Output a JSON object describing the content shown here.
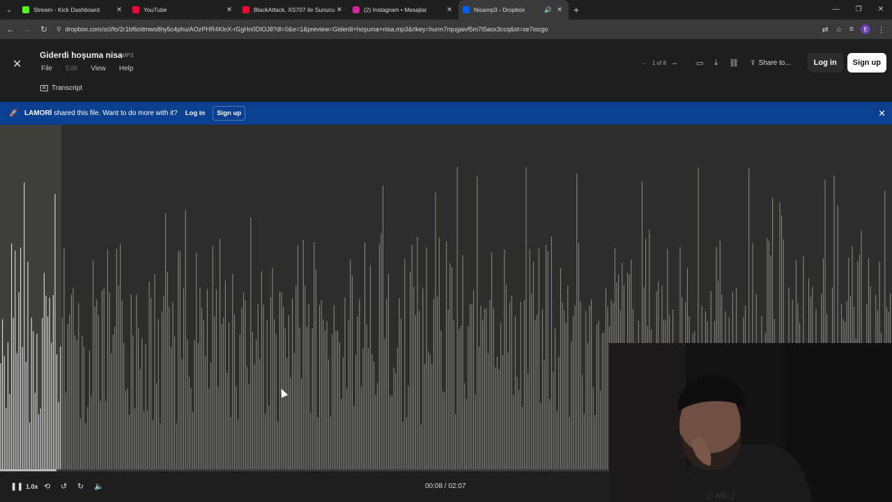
{
  "browser": {
    "tabs": [
      {
        "title": "Stream - Kick Dashboard",
        "favicon": "kick-icon",
        "color": "#53fc18",
        "active": false
      },
      {
        "title": "YouTube",
        "favicon": "youtube-icon",
        "color": "#ff0033",
        "active": false
      },
      {
        "title": "BlackAttack, XS707 ile Sunucu",
        "favicon": "youtube-icon",
        "color": "#ff0033",
        "active": false
      },
      {
        "title": "(2) Instagram • Mesajlar",
        "favicon": "instagram-icon",
        "color": "#d6249f",
        "active": false
      },
      {
        "title": "Nisamp3 - Dropbox",
        "favicon": "dropbox-icon",
        "color": "#0061ff",
        "active": true
      }
    ],
    "url": "dropbox.com/scl/fo/2r1bf6oitmws8hy5c4phu/AOzPHR4KlnX-rGgHn0DlOJ8?dl=0&e=1&preview=Giderdi+hoşuma+nisa.mp3&rlkey=hurm7rqugaivf5m7t5aox3ccq&st=se7iocgo",
    "profile_initial": "E"
  },
  "viewer": {
    "file_title": "Giderdi hoşuma nisa",
    "file_type": "MP3",
    "menu": {
      "file": "File",
      "edit": "Edit",
      "view": "View",
      "help": "Help"
    },
    "transcript": "Transcript",
    "pager": "1 of 8",
    "share": "Share to...",
    "login": "Log in",
    "signup": "Sign up"
  },
  "banner": {
    "user": "LAMORİ",
    "message": " shared this file. Want to do more with it?",
    "login": "Log in",
    "signup": "Sign up"
  },
  "player": {
    "speed": "1.0x",
    "current_time": "00:08",
    "duration": "02:07",
    "time_display": "00:08 / 02:07",
    "progress_fraction": 0.063
  },
  "colors": {
    "banner_bg": "#0b3f8f",
    "wave_played": "#f2f2f2",
    "wave_unplayed": "#8f8e8a"
  }
}
